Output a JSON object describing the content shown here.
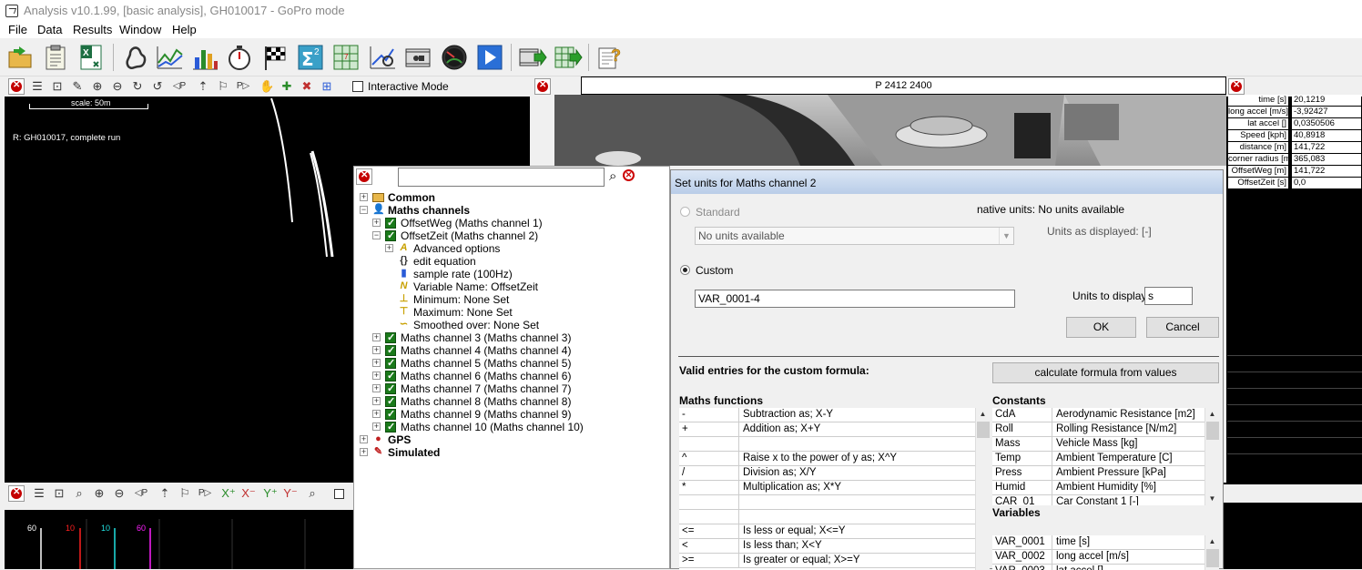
{
  "window": {
    "title": "Analysis v10.1.99, [basic analysis], GH010017 - GoPro mode"
  },
  "menu": [
    "File",
    "Data",
    "Results",
    "Window",
    "Help"
  ],
  "toolbar": {
    "icons": [
      "open-folder-icon",
      "clipboard-icon",
      "excel-export-icon",
      "track-map-icon",
      "line-graph-icon",
      "bar-chart-icon",
      "stopwatch-icon",
      "checkered-flag-icon",
      "sigma-squared-icon",
      "maths-grid-icon",
      "scatter-plot-icon",
      "video-icon",
      "gauge-icon",
      "play-icon",
      "video-export-icon",
      "table-export-icon",
      "help-icon"
    ]
  },
  "map_panel": {
    "interactive_mode_label": "Interactive Mode",
    "scale_label": "scale: 50m",
    "run_label": "R:  GH010017, complete run"
  },
  "video_panel": {
    "header": "P 2412 2400"
  },
  "data_table": {
    "rows": [
      {
        "label": "time [s]",
        "value": "20,1219"
      },
      {
        "label": "long accel [m/s]",
        "value": "-3,92427"
      },
      {
        "label": "lat accel []",
        "value": "0,0350506"
      },
      {
        "label": "Speed [kph]",
        "value": "40,8918"
      },
      {
        "label": "distance [m]",
        "value": "141,722"
      },
      {
        "label": "corner radius [m]",
        "value": "365,083"
      },
      {
        "label": "OffsetWeg [m]",
        "value": "141,722"
      },
      {
        "label": "OffsetZeit [s]",
        "value": "0,0"
      }
    ]
  },
  "graph_panel": {
    "axis_labels": [
      {
        "text": "60",
        "color": "#ffffff"
      },
      {
        "text": "10",
        "color": "#ff2020"
      },
      {
        "text": "10",
        "color": "#20e0e0"
      },
      {
        "text": "60",
        "color": "#ff20ff"
      }
    ]
  },
  "tree": {
    "search_value": "",
    "items": [
      {
        "label": "Common",
        "bold": true
      },
      {
        "label": "Maths channels",
        "bold": true
      },
      {
        "label": "OffsetWeg  (Maths channel 1)"
      },
      {
        "label": "OffsetZeit  (Maths channel 2)"
      },
      {
        "label": "Advanced options"
      },
      {
        "label": "edit equation"
      },
      {
        "label": "sample rate (100Hz)"
      },
      {
        "label": "Variable Name: OffsetZeit"
      },
      {
        "label": "Minimum: None Set"
      },
      {
        "label": "Maximum: None Set"
      },
      {
        "label": "Smoothed over: None Set"
      },
      {
        "label": "Maths channel 3  (Maths channel 3)"
      },
      {
        "label": "Maths channel 4  (Maths channel 4)"
      },
      {
        "label": "Maths channel 5  (Maths channel 5)"
      },
      {
        "label": "Maths channel 6  (Maths channel 6)"
      },
      {
        "label": "Maths channel 7  (Maths channel 7)"
      },
      {
        "label": "Maths channel 8  (Maths channel 8)"
      },
      {
        "label": "Maths channel 9  (Maths channel 9)"
      },
      {
        "label": "Maths channel 10  (Maths channel 10)"
      },
      {
        "label": "GPS",
        "bold": true
      },
      {
        "label": "Simulated",
        "bold": true
      }
    ]
  },
  "dialog": {
    "title": "Set units for Maths channel 2",
    "standard_label": "Standard",
    "native_units": "native units: No units available",
    "units_select_value": "No units available",
    "units_as_displayed": "Units as displayed: [-]",
    "custom_label": "Custom",
    "custom_value": "VAR_0001-4",
    "units_to_display_label": "Units to display:",
    "units_to_display_value": "s",
    "ok_label": "OK",
    "cancel_label": "Cancel",
    "valid_entries_heading": "Valid entries for the custom formula:",
    "calc_button_label": "calculate formula from values",
    "maths_functions_heading": "Maths functions",
    "maths_functions": [
      {
        "op": "-",
        "desc": "Subtraction as; X-Y"
      },
      {
        "op": "+",
        "desc": "Addition as; X+Y"
      },
      {
        "op": "",
        "desc": ""
      },
      {
        "op": "^",
        "desc": "Raise x to the power of y as; X^Y"
      },
      {
        "op": "/",
        "desc": "Division as; X/Y"
      },
      {
        "op": "*",
        "desc": "Multiplication as; X*Y"
      },
      {
        "op": "",
        "desc": ""
      },
      {
        "op": "",
        "desc": ""
      },
      {
        "op": "<=",
        "desc": "Is less or equal; X<=Y"
      },
      {
        "op": "<",
        "desc": "Is less than; X<Y"
      },
      {
        "op": ">=",
        "desc": "Is greater or equal; X>=Y"
      }
    ],
    "constants_heading": "Constants",
    "constants": [
      {
        "key": "CdA",
        "desc": "Aerodynamic Resistance [m2]"
      },
      {
        "key": "Roll",
        "desc": "Rolling Resistance [N/m2]"
      },
      {
        "key": "Mass",
        "desc": "Vehicle Mass [kg]"
      },
      {
        "key": "Temp",
        "desc": "Ambient Temperature [C]"
      },
      {
        "key": "Press",
        "desc": "Ambient Pressure [kPa]"
      },
      {
        "key": "Humid",
        "desc": "Ambient Humidity [%]"
      },
      {
        "key": "CAR_01",
        "desc": "Car Constant 1 [-]"
      }
    ],
    "variables_heading": "Variables",
    "variables": [
      {
        "key": "VAR_0001",
        "desc": "time [s]"
      },
      {
        "key": "VAR_0002",
        "desc": "long accel [m/s]"
      },
      {
        "key": "VAR_0003",
        "desc": "lat accel []"
      }
    ]
  }
}
